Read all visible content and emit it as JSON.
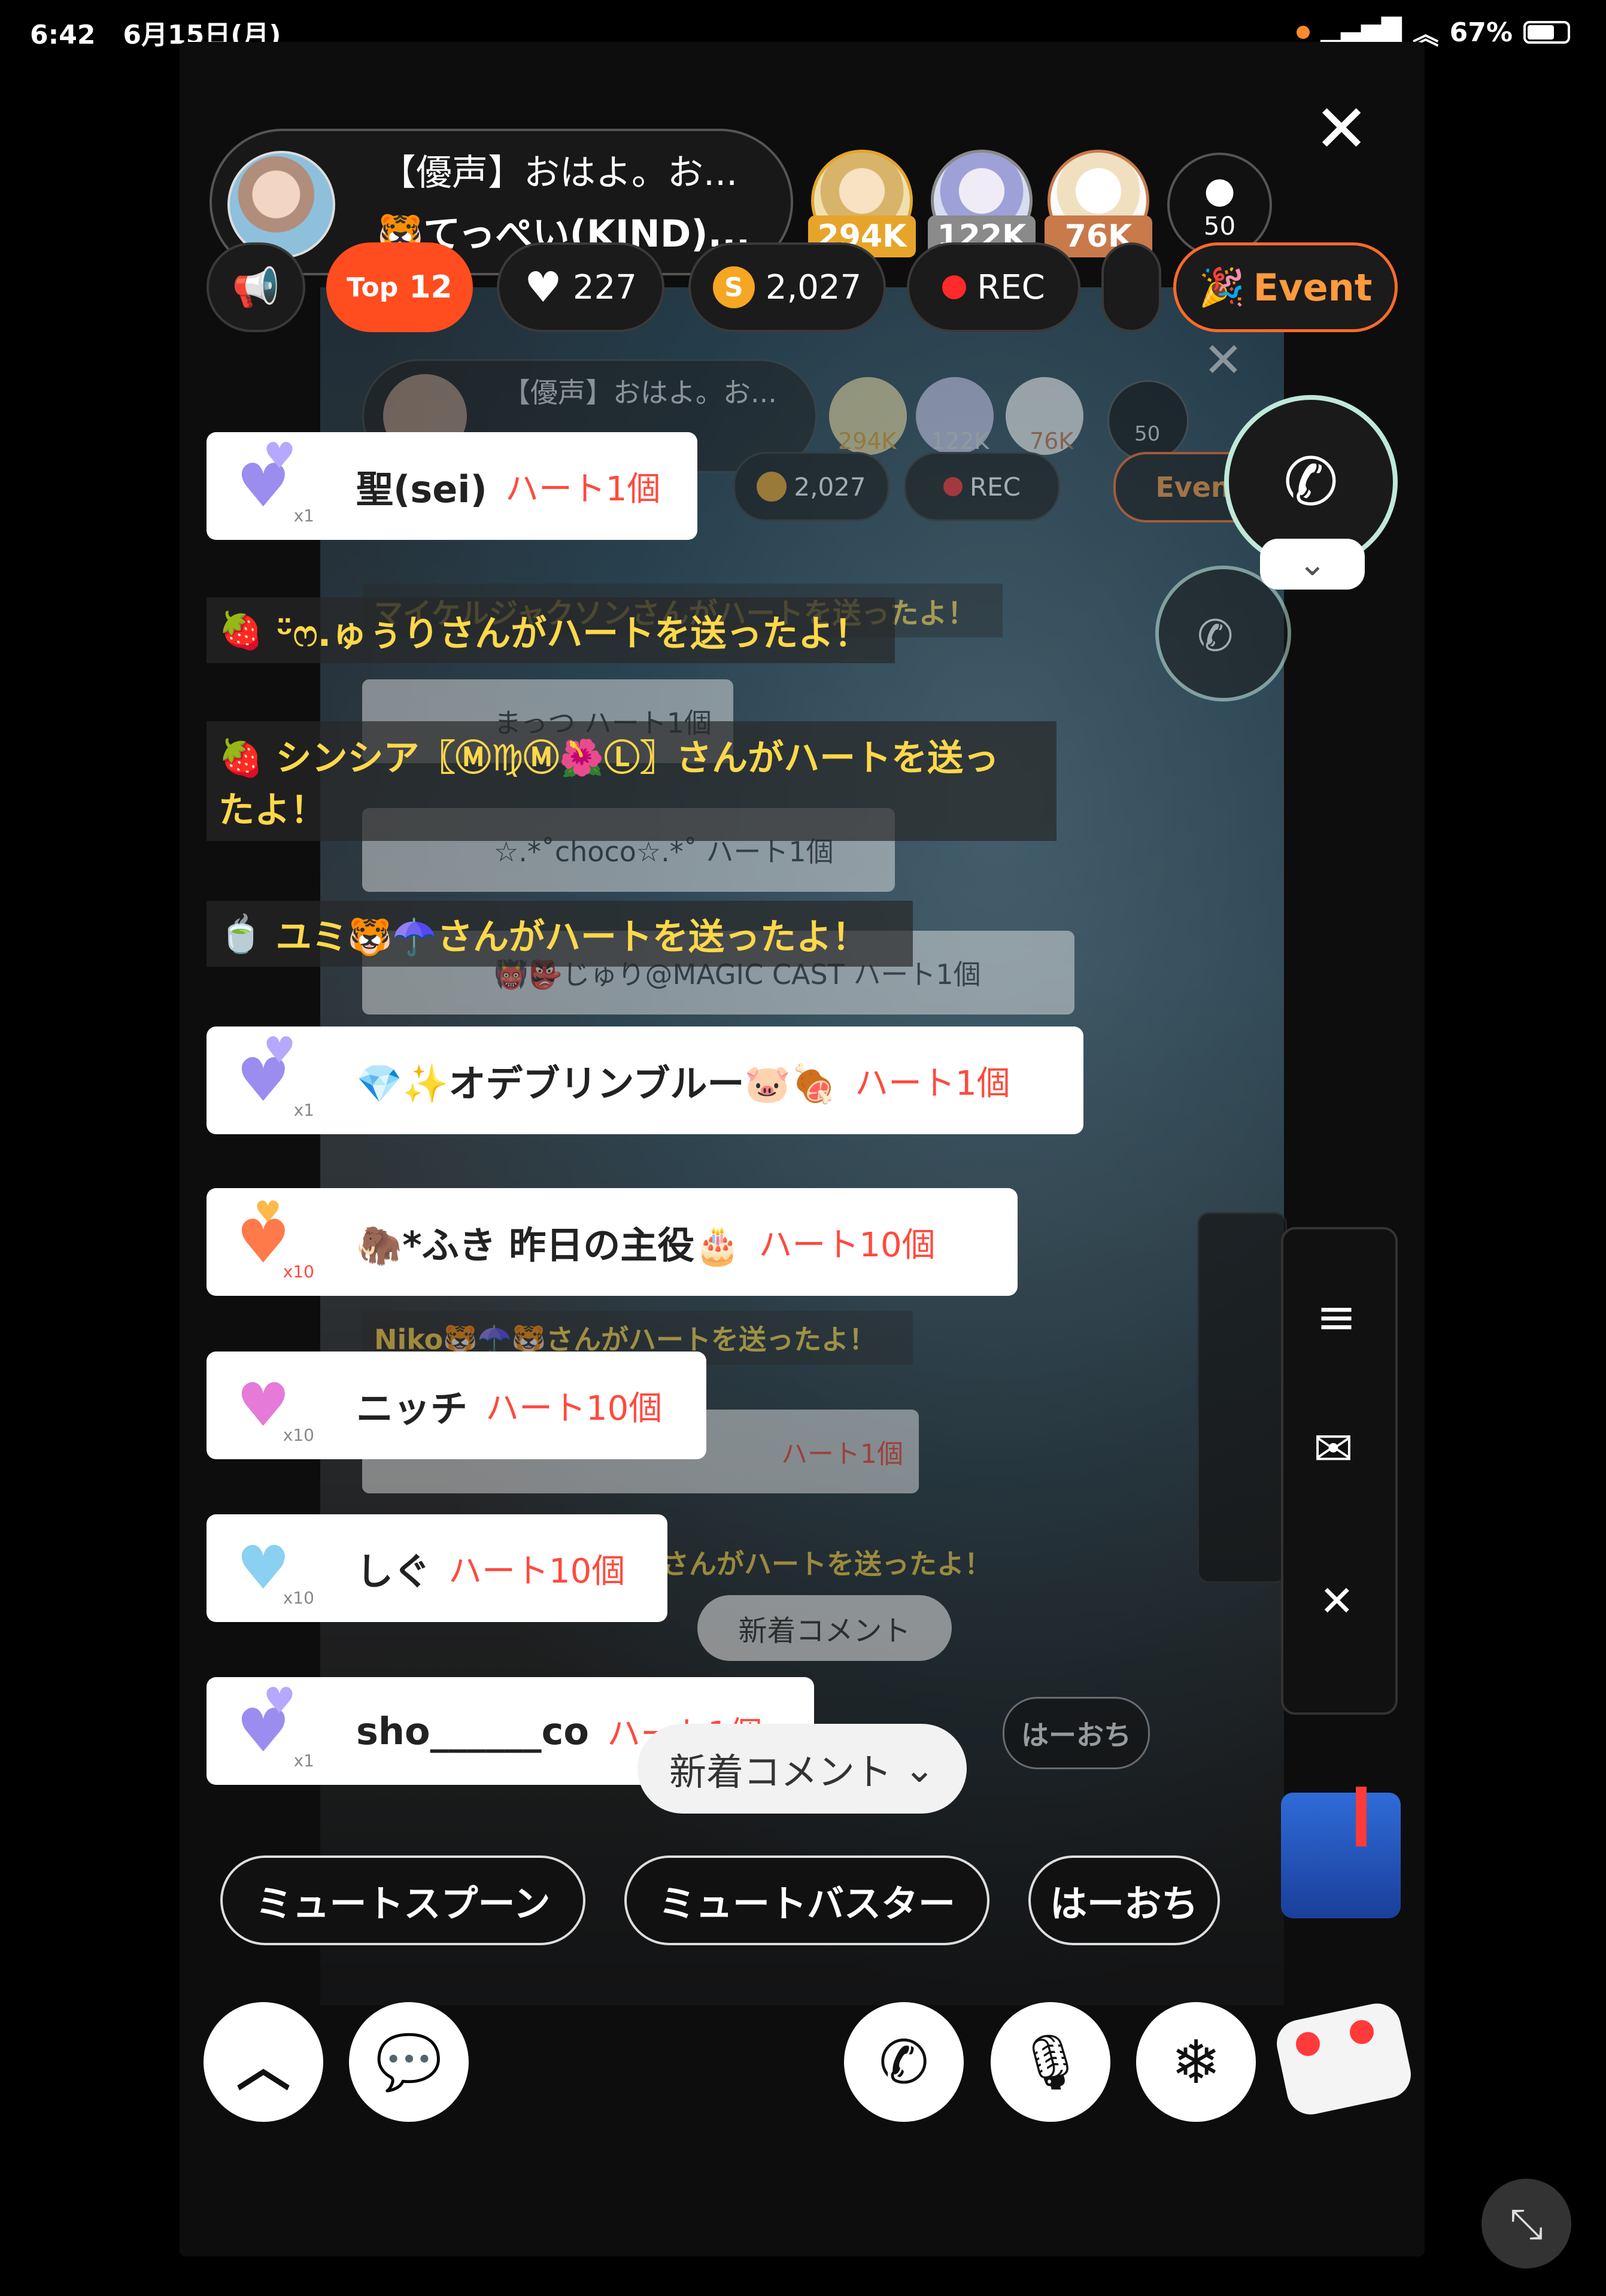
{
  "status_bar": {
    "time": "6:42",
    "date": "6月15日(月)",
    "battery": "67%"
  },
  "header": {
    "host_title": "【優声】おはよ。お...",
    "host_subtitle": "🐯てっぺい(KIND)...",
    "ranks": [
      {
        "value": "294K",
        "color": "#e6a52a"
      },
      {
        "value": "122K",
        "color": "#8a8a8a"
      },
      {
        "value": "76K",
        "color": "#c97a4a"
      }
    ],
    "viewers": "50",
    "chips": {
      "top_label": "Top",
      "top_value": "12",
      "likes": "227",
      "coins": "2,027",
      "rec": "REC",
      "event": "Event"
    }
  },
  "ghost": {
    "host_title": "【優声】おはよ。お...",
    "coins": "2,027",
    "rec": "REC",
    "event": "Event",
    "ranks": [
      "294K",
      "122K",
      "76K"
    ],
    "viewers": "50",
    "lines": [
      "マイケルジャクソンさんがハートを送ったよ！",
      "まっつ ハート1個",
      "☆.*˚choco☆.*˚ ハート1個",
      "👹👺じゅり@MAGIC CAST ハート1個",
      "Niko🐯☂️🐯さんがハートを送ったよ！",
      "ハート1個",
      "さんがハートを送ったよ！",
      "新着コメント",
      "はーおち"
    ]
  },
  "gifts": [
    {
      "name": "聖(sei)",
      "count": "ハート1個",
      "icon": "purple-hearts-icon",
      "multiplier": "x1"
    },
    {
      "name": "💎✨オデブリンブルー🐷🍖",
      "count": "ハート1個",
      "icon": "purple-hearts-icon",
      "multiplier": "x1"
    },
    {
      "name": "🦣*ふき 昨日の主役🎂",
      "count": "ハート10個",
      "icon": "heart-gift-box-icon",
      "multiplier": "x10"
    },
    {
      "name": "ニッチ",
      "count": "ハート10個",
      "icon": "pink-crystal-heart-icon",
      "multiplier": "x10"
    },
    {
      "name": "しぐ",
      "count": "ハート10個",
      "icon": "rainbow-heart-icon",
      "multiplier": "x10"
    },
    {
      "name": "sho______co",
      "count": "ハート1個",
      "icon": "purple-hearts-icon",
      "multiplier": "x1"
    }
  ],
  "notices": [
    {
      "icon": "🍓",
      "text": "ᵕ̈ෆ.ゅぅりさんがハートを送ったよ！"
    },
    {
      "icon": "🍓",
      "text": "シンシア〖Ⓜ♍Ⓜ🌺Ⓛ〗さんがハートを送っ",
      "text2": "たよ！"
    },
    {
      "icon": "🍵",
      "text": "ユミ🐯☂️さんがハートを送ったよ！"
    }
  ],
  "bottom": {
    "mute_spoon": "ミュートスプーン",
    "mute_buster": "ミュートバスター",
    "ha_ochi": "はーおち",
    "new_comment": "新着コメント"
  },
  "colors": {
    "accent": "#ff4d1f",
    "gift_count": "#ff4a3d",
    "notice": "#ffd84a",
    "event": "#ff9a3d"
  }
}
